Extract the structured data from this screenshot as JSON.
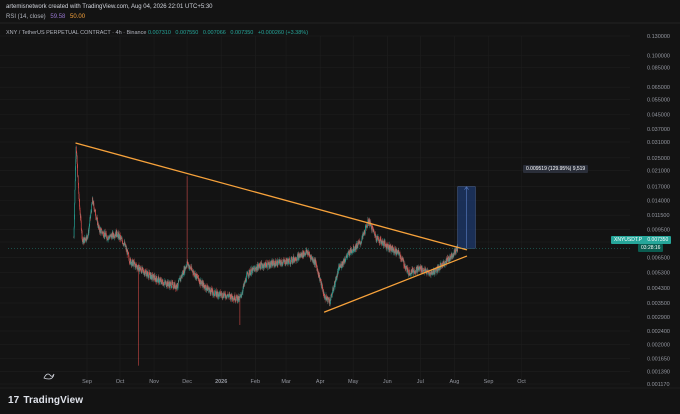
{
  "header": {
    "credit": "artemisnetwork created with TradingView.com, Aug 04, 2026 22:01 UTC+5:30"
  },
  "rsi": {
    "label": "RSI (14, close)",
    "value1": "59.58",
    "value2": "50.00"
  },
  "symbol_bar": {
    "title": "XNY / TetherUS PERPETUAL CONTRACT · 4h · Binance",
    "o": "0.007310",
    "h": "0.007550",
    "l": "0.007066",
    "c": "0.007350",
    "change": "+0.000260 (+3.38%)"
  },
  "measure_label": "0.009519 (129.95%) 9,519",
  "ticker_pill": {
    "label": "XNYUSDT.P",
    "price": "0.007350",
    "timer": "03:28:16"
  },
  "brand": "TradingView",
  "colors": {
    "background": "#131313",
    "grid": "#1e1e1e",
    "bull": "#26a69a",
    "bear": "#ef5350",
    "trendline": "#f7a23b",
    "measure_fill": "#1e3a6e",
    "measure_line": "#5b7fc7",
    "pill_green": "#26a69a",
    "pill_dark": "#0b5c50"
  },
  "chart_data": {
    "type": "candlestick",
    "y_scale": "log",
    "y_ticks": [
      "0.130000",
      "0.100000",
      "0.085000",
      "0.065000",
      "0.055000",
      "0.045000",
      "0.037000",
      "0.031000",
      "0.025000",
      "0.021000",
      "0.017000",
      "0.014000",
      "0.011500",
      "0.009500",
      "0.008000",
      "0.006500",
      "0.005300",
      "0.004300",
      "0.003500",
      "0.002900",
      "0.002400",
      "0.002000",
      "0.001650",
      "0.001390",
      "0.001170"
    ],
    "x_ticks": [
      "Sep",
      "Oct",
      "Nov",
      "Dec",
      "2026",
      "Feb",
      "Mar",
      "Apr",
      "May",
      "Jun",
      "Jul",
      "Aug",
      "Sep",
      "Oct"
    ],
    "price_path": [
      {
        "date": "2025-08-20",
        "price": 0.0085
      },
      {
        "date": "2025-08-22",
        "price": 0.03
      },
      {
        "date": "2025-08-25",
        "price": 0.0135
      },
      {
        "date": "2025-08-28",
        "price": 0.008
      },
      {
        "date": "2025-09-02",
        "price": 0.0088
      },
      {
        "date": "2025-09-06",
        "price": 0.014
      },
      {
        "date": "2025-09-12",
        "price": 0.0095
      },
      {
        "date": "2025-09-20",
        "price": 0.0085
      },
      {
        "date": "2025-09-28",
        "price": 0.009
      },
      {
        "date": "2025-10-05",
        "price": 0.0078
      },
      {
        "date": "2025-10-10",
        "price": 0.0062
      },
      {
        "date": "2025-10-20",
        "price": 0.0055
      },
      {
        "date": "2025-10-30",
        "price": 0.005
      },
      {
        "date": "2025-11-10",
        "price": 0.0046
      },
      {
        "date": "2025-11-22",
        "price": 0.0044
      },
      {
        "date": "2025-12-01",
        "price": 0.006
      },
      {
        "date": "2025-12-05",
        "price": 0.0055
      },
      {
        "date": "2025-12-15",
        "price": 0.0045
      },
      {
        "date": "2025-12-25",
        "price": 0.004
      },
      {
        "date": "2026-01-05",
        "price": 0.0039
      },
      {
        "date": "2026-01-18",
        "price": 0.0037
      },
      {
        "date": "2026-01-25",
        "price": 0.0052
      },
      {
        "date": "2026-02-05",
        "price": 0.0058
      },
      {
        "date": "2026-02-20",
        "price": 0.006
      },
      {
        "date": "2026-03-05",
        "price": 0.0062
      },
      {
        "date": "2026-03-20",
        "price": 0.007
      },
      {
        "date": "2026-03-28",
        "price": 0.006
      },
      {
        "date": "2026-04-05",
        "price": 0.0038
      },
      {
        "date": "2026-04-10",
        "price": 0.0036
      },
      {
        "date": "2026-04-18",
        "price": 0.0056
      },
      {
        "date": "2026-04-28",
        "price": 0.007
      },
      {
        "date": "2026-05-08",
        "price": 0.008
      },
      {
        "date": "2026-05-15",
        "price": 0.0107
      },
      {
        "date": "2026-05-22",
        "price": 0.0085
      },
      {
        "date": "2026-06-02",
        "price": 0.0075
      },
      {
        "date": "2026-06-12",
        "price": 0.0068
      },
      {
        "date": "2026-06-20",
        "price": 0.0053
      },
      {
        "date": "2026-07-01",
        "price": 0.0056
      },
      {
        "date": "2026-07-10",
        "price": 0.0052
      },
      {
        "date": "2026-07-20",
        "price": 0.0058
      },
      {
        "date": "2026-07-28",
        "price": 0.0065
      },
      {
        "date": "2026-08-04",
        "price": 0.00735
      }
    ],
    "spikes": [
      {
        "date": "2025-10-18",
        "low": 0.0015
      },
      {
        "date": "2025-12-01",
        "high": 0.0195
      },
      {
        "date": "2026-01-18",
        "low": 0.0026
      }
    ],
    "trendlines": [
      {
        "from": {
          "date": "2025-08-22",
          "price": 0.0305
        },
        "to": {
          "date": "2026-08-12",
          "price": 0.0072
        }
      },
      {
        "from": {
          "date": "2026-04-05",
          "price": 0.0031
        },
        "to": {
          "date": "2026-08-12",
          "price": 0.0066
        }
      }
    ],
    "measure_box": {
      "date_from": "2026-08-04",
      "date_to": "2026-08-20",
      "price_from": 0.00735,
      "price_to": 0.0169
    }
  }
}
